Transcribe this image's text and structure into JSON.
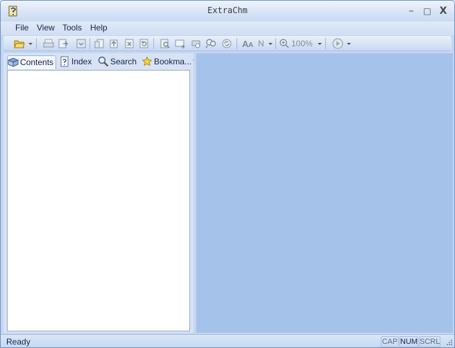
{
  "window": {
    "title": "ExtraChm",
    "minimize_glyph": "–",
    "maximize_glyph": "□",
    "close_glyph": "X"
  },
  "menu": {
    "items": [
      {
        "label": "File"
      },
      {
        "label": "View"
      },
      {
        "label": "Tools"
      },
      {
        "label": "Help"
      }
    ]
  },
  "toolbar": {
    "font_size_label": "N",
    "zoom_label": "100%",
    "icons": [
      "open-folder-icon",
      "print-icon",
      "forward-page-icon",
      "save-icon",
      "copy-icon",
      "up-icon",
      "stop-icon",
      "refresh-icon",
      "find-icon",
      "add-icon",
      "print-preview-icon",
      "search-icon",
      "sync-icon",
      "font-size-icon",
      "zoom-icon",
      "play-icon"
    ]
  },
  "sidebar": {
    "tabs": [
      {
        "label": "Contents",
        "icon": "book-question-icon",
        "active": true
      },
      {
        "label": "Index",
        "icon": "document-question-icon",
        "active": false
      },
      {
        "label": "Search",
        "icon": "magnifier-icon",
        "active": false
      },
      {
        "label": "Bookma...",
        "icon": "star-icon",
        "active": false
      }
    ]
  },
  "status": {
    "text": "Ready",
    "indicators": [
      {
        "label": "CAP",
        "active": false
      },
      {
        "label": "NUM",
        "active": true
      },
      {
        "label": "SCRL",
        "active": false
      }
    ]
  },
  "colors": {
    "content_background": "#a5c3ea",
    "frame": "#c4d6f0"
  }
}
